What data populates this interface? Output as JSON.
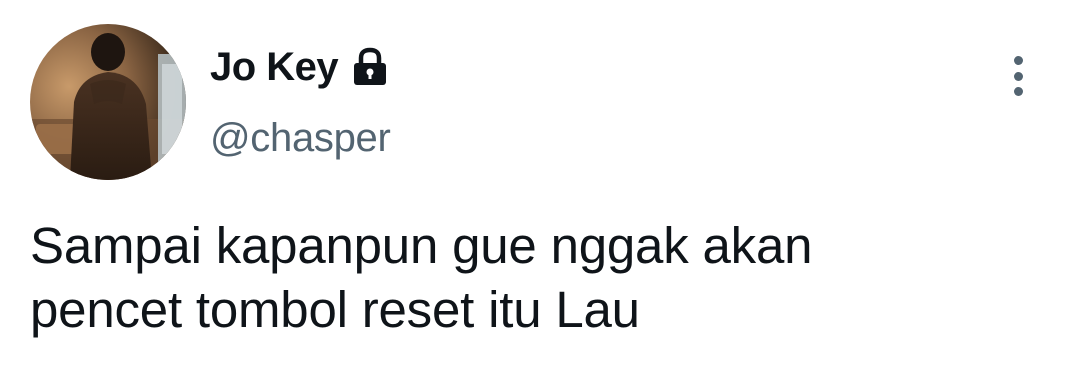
{
  "author": {
    "display_name": "Jo Key",
    "handle": "@chasper",
    "protected_icon": "lock-icon",
    "avatar_icon": "avatar-photo"
  },
  "menu": {
    "icon": "more-vertical-icon"
  },
  "tweet": {
    "text_line_1": "Sampai kapanpun gue nggak akan",
    "text_line_2": "pencet tombol reset itu Lau"
  },
  "colors": {
    "text_primary": "#0f1419",
    "text_secondary": "#536471",
    "background": "#ffffff"
  }
}
